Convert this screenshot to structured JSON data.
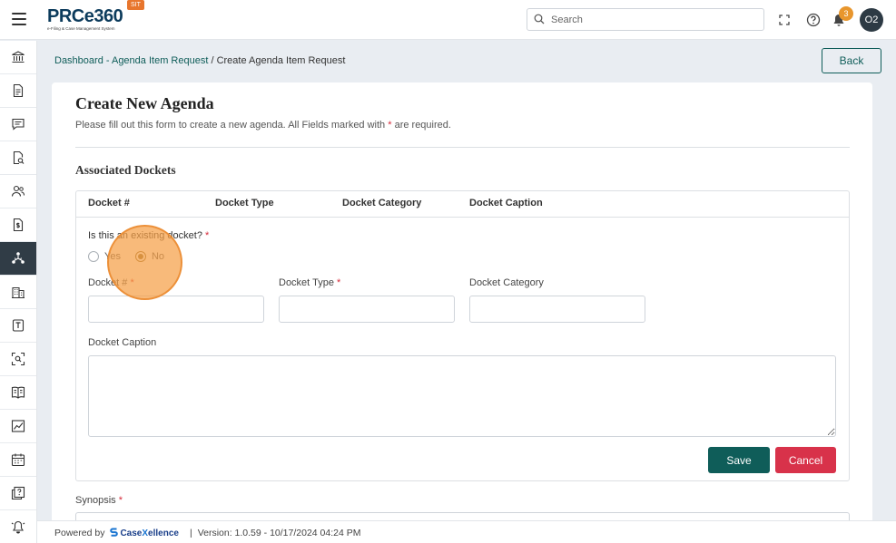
{
  "header": {
    "brand": "PRCe360",
    "tagline": "e-Filing & Case Management System",
    "env_badge": "SIT",
    "search_placeholder": "Search",
    "notification_count": "3",
    "user_initials": "O2"
  },
  "sidebar": {
    "items": [
      {
        "name": "sidebar-item-institution",
        "icon": "bank-icon"
      },
      {
        "name": "sidebar-item-documents",
        "icon": "document-icon"
      },
      {
        "name": "sidebar-item-messages",
        "icon": "chat-icon"
      },
      {
        "name": "sidebar-item-search-documents",
        "icon": "document-search-icon"
      },
      {
        "name": "sidebar-item-users",
        "icon": "users-icon"
      },
      {
        "name": "sidebar-item-billing",
        "icon": "dollar-document-icon"
      },
      {
        "name": "sidebar-item-agenda",
        "icon": "workflow-icon",
        "active": true
      },
      {
        "name": "sidebar-item-organizations",
        "icon": "building-icon"
      },
      {
        "name": "sidebar-item-templates",
        "icon": "template-icon"
      },
      {
        "name": "sidebar-item-scan",
        "icon": "scan-icon"
      },
      {
        "name": "sidebar-item-library",
        "icon": "book-icon"
      },
      {
        "name": "sidebar-item-reports",
        "icon": "chart-icon"
      },
      {
        "name": "sidebar-item-calendar",
        "icon": "calendar-icon"
      },
      {
        "name": "sidebar-item-help",
        "icon": "help-docs-icon"
      },
      {
        "name": "sidebar-item-alerts",
        "icon": "bell-icon"
      }
    ]
  },
  "breadcrumb": {
    "link": "Dashboard - Agenda Item Request",
    "separator": " / ",
    "current": "Create Agenda Item Request"
  },
  "back_label": "Back",
  "form": {
    "title": "Create New Agenda",
    "subtitle_before": "Please fill out this form to create a new agenda. All Fields marked with ",
    "required_mark": "*",
    "subtitle_after": " are required.",
    "section_title": "Associated Dockets",
    "table_headers": [
      "Docket #",
      "Docket Type",
      "Docket Category",
      "Docket Caption"
    ],
    "existing_question": "Is this an existing docket?",
    "radio_yes": "Yes",
    "radio_no": "No",
    "radio_selected": "No",
    "docket_number_label": "Docket #",
    "docket_type_label": "Docket Type",
    "docket_category_label": "Docket Category",
    "docket_caption_label": "Docket Caption",
    "save_label": "Save",
    "cancel_label": "Cancel",
    "synopsis_label": "Synopsis"
  },
  "footer": {
    "powered_by": "Powered by",
    "company_prefix": "Case",
    "company_x": "X",
    "company_suffix": "ellence",
    "separator": "|",
    "version": "Version: 1.0.59 - 10/17/2024 04:24 PM"
  }
}
